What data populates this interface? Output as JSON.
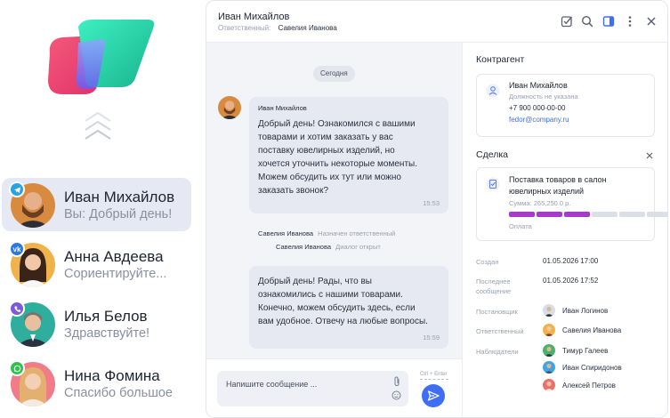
{
  "contacts": [
    {
      "name": "Иван Михайлов",
      "message": "Вы: Добрый день!",
      "channel": "telegram-icon",
      "channel_color": "#2aa4e0",
      "active": true
    },
    {
      "name": "Анна Авдеева",
      "message": "Сориентируйте...",
      "channel": "vk-icon",
      "channel_color": "#2a78e4",
      "active": false
    },
    {
      "name": "Илья Белов",
      "message": "Здравствуйте!",
      "channel": "viber-icon",
      "channel_color": "#7d5bd6",
      "active": false
    },
    {
      "name": "Нина Фомина",
      "message": "Спасибо большое",
      "channel": "whatsapp-icon",
      "channel_color": "#2dc34f",
      "active": false
    }
  ],
  "header": {
    "title": "Иван Михайлов",
    "responsible_label": "Ответственный:",
    "responsible_name": "Савелия Иванова"
  },
  "chat": {
    "date": "Сегодня",
    "incoming": {
      "author": "Иван Михайлов",
      "lines": [
        "Добрый день! Ознакомился с вашими",
        "товарами и хотим заказать у вас",
        "поставку ювелирных изделий, но",
        "хочется уточнить некоторые моменты.",
        "Можем обсудить их тут или можно",
        "заказать звонок?"
      ],
      "time": "15:53"
    },
    "system": [
      {
        "who": "Савелия Иванова",
        "event": "Назначен ответственный"
      },
      {
        "who": "Савелия Иванова",
        "event": "Диалог открыт"
      }
    ],
    "outgoing": {
      "lines": [
        "Добрый день! Рады, что вы",
        "ознакомились с нашими товарами.",
        "Конечно, можем обсудить здесь, если",
        "вам удобное. Отвечу на любые вопросы."
      ],
      "time": "15:59"
    }
  },
  "composer": {
    "placeholder": "Напишите сообщение ...",
    "hint": "Ctrl + Enter"
  },
  "counterparty": {
    "title": "Контрагент",
    "name": "Иван Михайлов",
    "position": "Должность не указана",
    "phone": "+7 900 000-00-00",
    "email": "fedor@company.ru"
  },
  "deal": {
    "title": "Сделка",
    "name_line1": "Поставка товаров в салон",
    "name_line2": "ювелирных изделий",
    "amount": "Сумма: 265,250.0 р.",
    "status": "Оплата",
    "stages_total": 6,
    "stages_done": 3,
    "done_color": "#a73bc9",
    "pending_color": "#dcdfe7"
  },
  "details": {
    "created_label": "Создан",
    "created_value": "01.05.2026 17:00",
    "last_msg_label_1": "Последнее",
    "last_msg_label_2": "сообщение",
    "last_msg_value": "01.05.2026 17:52",
    "director_label": "Постановщик",
    "director": "Иван Логинов",
    "responsible_label": "Ответственный",
    "responsible": "Савелия Иванова",
    "observers_label": "Наблюдатели",
    "observers": [
      "Тимур Галеев",
      "Иван Спиридонов",
      "Алексей Петров"
    ]
  },
  "colors": {
    "accent": "#3d6ef5",
    "link": "#3d6ef5",
    "active_row": "#e6e9f4",
    "bubble": "#e7e9f2"
  }
}
